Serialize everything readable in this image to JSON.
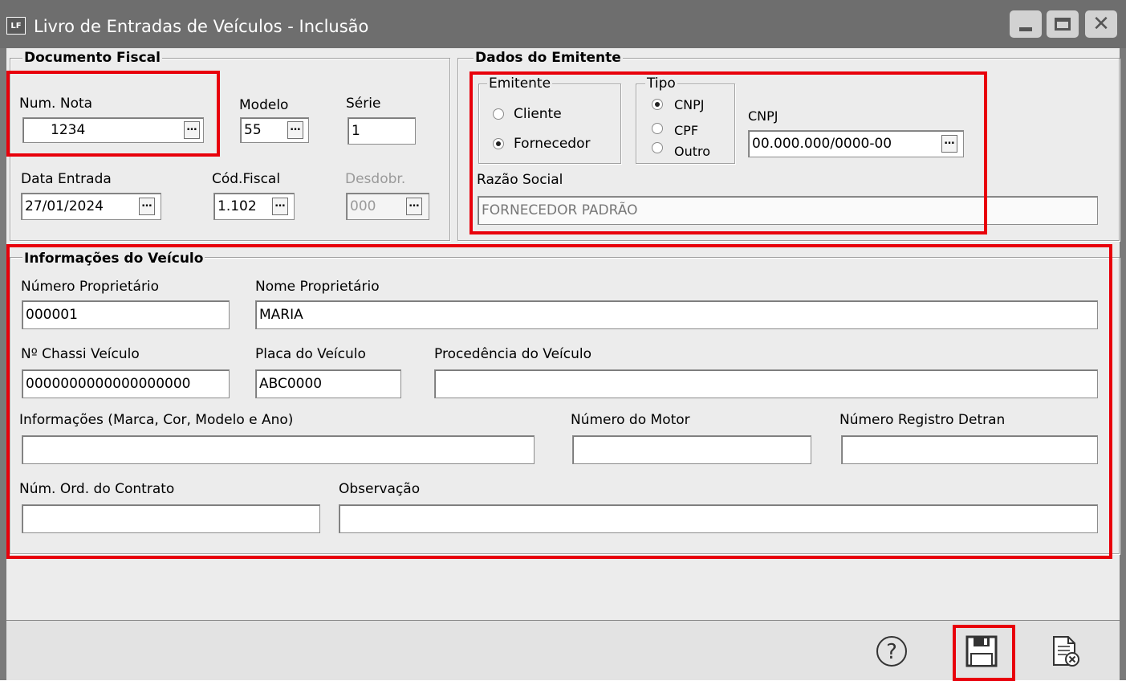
{
  "window": {
    "icon_text": "LF",
    "title": "Livro de Entradas de Veículos - Inclusão"
  },
  "documento_fiscal": {
    "legend": "Documento Fiscal",
    "num_nota": {
      "label": "Num. Nota",
      "value": "1234"
    },
    "modelo": {
      "label": "Modelo",
      "value": "55"
    },
    "serie": {
      "label": "Série",
      "value": "1"
    },
    "data_entrada": {
      "label": "Data Entrada",
      "value": "27/01/2024"
    },
    "cod_fiscal": {
      "label": "Cód.Fiscal",
      "value": "1.102"
    },
    "desdobr": {
      "label": "Desdobr.",
      "value": "000"
    }
  },
  "dados_emitente": {
    "legend": "Dados do Emitente",
    "emitente": {
      "legend": "Emitente",
      "options": [
        "Cliente",
        "Fornecedor"
      ],
      "selected": "Fornecedor"
    },
    "tipo": {
      "legend": "Tipo",
      "options": [
        "CNPJ",
        "CPF",
        "Outro"
      ],
      "selected": "CNPJ"
    },
    "cnpj": {
      "label": "CNPJ",
      "value": "00.000.000/0000-00"
    },
    "razao_social": {
      "label": "Razão Social",
      "value": "FORNECEDOR PADRÃO"
    }
  },
  "veiculo": {
    "legend": "Informações do Veículo",
    "numero_proprietario": {
      "label": "Número Proprietário",
      "value": "000001"
    },
    "nome_proprietario": {
      "label": "Nome Proprietário",
      "value": "MARIA"
    },
    "chassi": {
      "label": "Nº Chassi Veículo",
      "value": "0000000000000000000"
    },
    "placa": {
      "label": "Placa do Veículo",
      "value": "ABC0000"
    },
    "procedencia": {
      "label": "Procedência do Veículo",
      "value": ""
    },
    "informacoes": {
      "label": "Informações (Marca,  Cor,  Modelo e Ano)",
      "value": ""
    },
    "numero_motor": {
      "label": "Número do Motor",
      "value": ""
    },
    "registro_detran": {
      "label": "Número Registro Detran",
      "value": ""
    },
    "num_ord_contrato": {
      "label": "Núm. Ord. do Contrato",
      "value": ""
    },
    "observacao": {
      "label": "Observação",
      "value": ""
    }
  },
  "toolbar": {
    "help_icon": "help-circle-icon",
    "save_icon": "floppy-disk-icon",
    "cancel_icon": "document-cancel-icon"
  },
  "colors": {
    "highlight": "#e8000b",
    "titlebar": "#6e6e6e",
    "client": "#ececec"
  }
}
